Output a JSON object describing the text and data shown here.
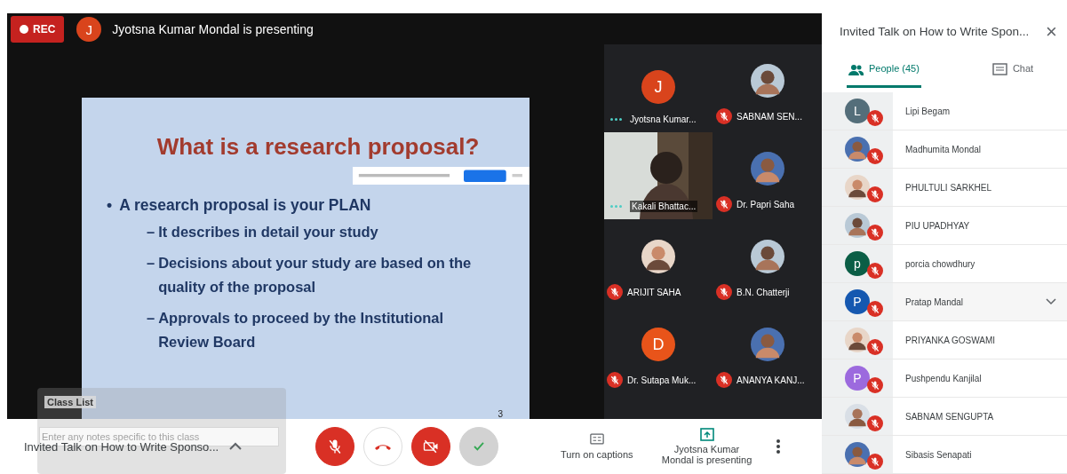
{
  "header": {
    "rec_label": "REC",
    "presenter_avatar": "J",
    "presenting_text": "Jyotsna Kumar Mondal is presenting"
  },
  "slide": {
    "title": "What is a research proposal?",
    "bullets": [
      {
        "marker": "•",
        "text": "A research proposal is your PLAN",
        "children": [
          {
            "marker": "–",
            "text": "It describes in detail your study"
          },
          {
            "marker": "–",
            "text": "Decisions about your study are based on the quality of the proposal"
          },
          {
            "marker": "–",
            "text": "Approvals to proceed by the Institutional Review Board"
          }
        ]
      }
    ],
    "page_number": "3"
  },
  "tiles": [
    {
      "name": "Jyotsna Kumar...",
      "muted": false,
      "avatar": {
        "kind": "letter",
        "letter": "J",
        "color": "#d9441c"
      }
    },
    {
      "name": "SABNAM SEN...",
      "muted": true
    },
    {
      "name": "Kakali Bhattac...",
      "muted": false,
      "avatar": {
        "kind": "video"
      }
    },
    {
      "name": "Dr. Papri Saha",
      "muted": true
    },
    {
      "name": "ARIJIT SAHA",
      "muted": true
    },
    {
      "name": "B.N. Chatterji",
      "muted": true
    },
    {
      "name": "Dr. Sutapa Muk...",
      "muted": true,
      "avatar": {
        "kind": "letter",
        "letter": "D",
        "color": "#e8541a"
      }
    },
    {
      "name": "ANANYA KANJ...",
      "muted": true
    }
  ],
  "class_list_overlay": {
    "title": "Class List",
    "placeholder": "Enter any notes specific to this class"
  },
  "bottom_bar": {
    "meeting_title": "Invited Talk on How to Write Sponso...",
    "controls": [
      {
        "kind": "mic",
        "on": false
      },
      {
        "kind": "hangup"
      },
      {
        "kind": "camera",
        "on": false
      },
      {
        "kind": "check"
      }
    ],
    "captions_label": "Turn on captions",
    "presenting_label": "Jyotsna Kumar Mondal is presenting"
  },
  "panel": {
    "title": "Invited Talk on How to Write Spon...",
    "close": "×",
    "tabs": [
      {
        "label": "People (45)",
        "kind": "people",
        "selected": true
      },
      {
        "label": "Chat",
        "kind": "chat",
        "selected": false
      }
    ],
    "people": [
      {
        "name": "Lipi Begam",
        "muted": true,
        "selected": false,
        "avatar": {
          "kind": "letter",
          "letter": "L",
          "color": "#546e7a"
        }
      },
      {
        "name": "Madhumita Mondal",
        "muted": true,
        "selected": false
      },
      {
        "name": "PHULTULI SARKHEL",
        "muted": true,
        "selected": false
      },
      {
        "name": "PIU UPADHYAY",
        "muted": true,
        "selected": false
      },
      {
        "name": "porcia chowdhury",
        "muted": true,
        "selected": false,
        "avatar": {
          "kind": "letter",
          "letter": "p",
          "color": "#0b5e46"
        }
      },
      {
        "name": "Pratap Mandal",
        "muted": true,
        "selected": true,
        "avatar": {
          "kind": "letter",
          "letter": "P",
          "color": "#1558b0"
        }
      },
      {
        "name": "PRIYANKA GOSWAMI",
        "muted": true,
        "selected": false
      },
      {
        "name": "Pushpendu Kanjilal",
        "muted": true,
        "selected": false,
        "avatar": {
          "kind": "letter",
          "letter": "P",
          "color": "#9c6ade"
        }
      },
      {
        "name": "SABNAM SENGUPTA",
        "muted": true,
        "selected": false
      },
      {
        "name": "Sibasis Senapati",
        "muted": true,
        "selected": false
      }
    ]
  }
}
